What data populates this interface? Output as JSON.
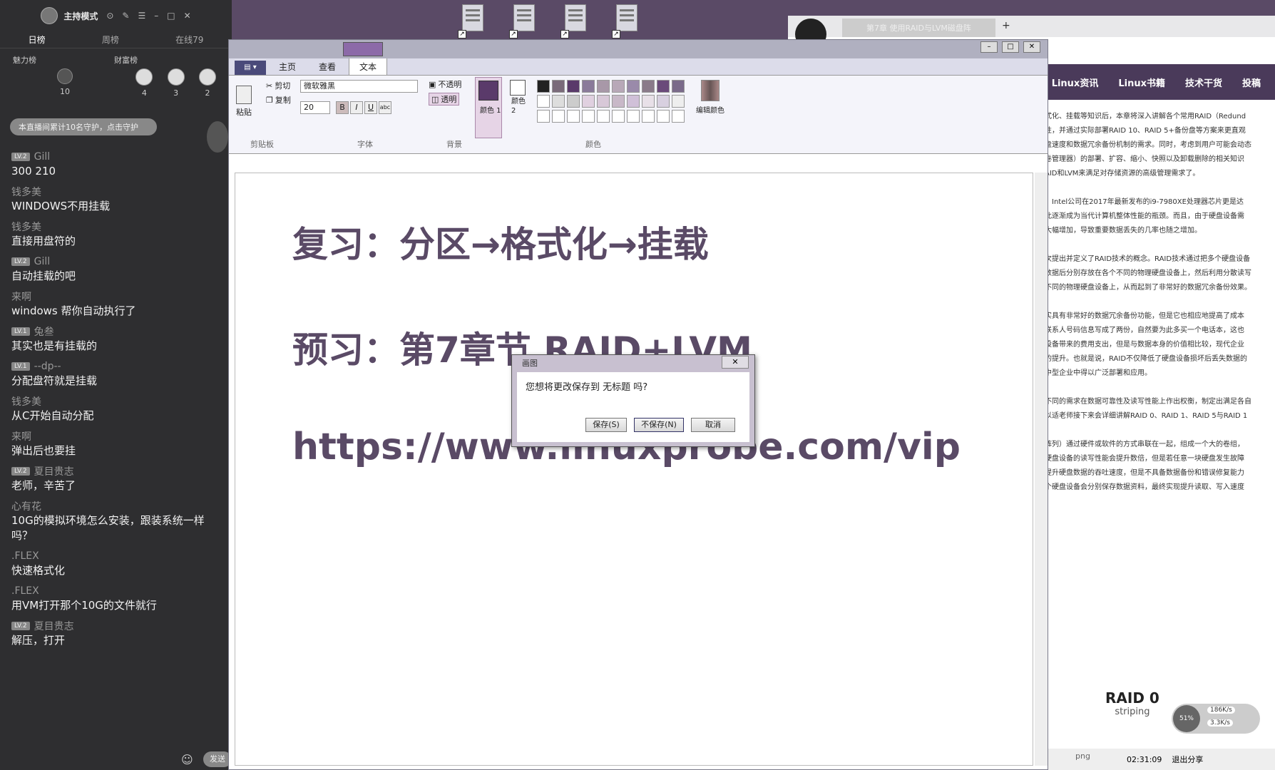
{
  "live_panel": {
    "title": "主持模式",
    "tabs": [
      "日榜",
      "周榜",
      "在线79"
    ],
    "rank_labels": {
      "charm": "魅力榜",
      "wealth": "财富榜"
    },
    "rank_counts": [
      "10",
      "4",
      "3",
      "2"
    ],
    "announcement": "本直播间累计10名守护，点击守护",
    "messages": [
      {
        "user": "Gill",
        "level": "LV.2",
        "text": "300 210"
      },
      {
        "user": "钱多美",
        "level": "",
        "text": "WINDOWS不用挂载"
      },
      {
        "user": "钱多美",
        "level": "",
        "text": "直接用盘符的"
      },
      {
        "user": "Gill",
        "level": "LV.2",
        "text": "自动挂载的吧"
      },
      {
        "user": "来啊",
        "level": "",
        "text": "windows 帮你自动执行了"
      },
      {
        "user": "兔叁",
        "level": "LV.1",
        "text": "其实也是有挂载的"
      },
      {
        "user": "--dp--",
        "level": "LV.1",
        "text": "分配盘符就是挂载"
      },
      {
        "user": "钱多美",
        "level": "",
        "text": "从C开始自动分配"
      },
      {
        "user": "来啊",
        "level": "",
        "text": "弹出后也要挂"
      },
      {
        "user": "夏目贵志",
        "level": "LV.2",
        "text": "老师，辛苦了"
      },
      {
        "user": "心有花",
        "level": "",
        "text": "10G的模拟环境怎么安装，跟装系统一样吗？"
      },
      {
        "user": ".FLEX",
        "level": "",
        "text": "快速格式化"
      },
      {
        "user": ".FLEX",
        "level": "",
        "text": "用VM打开那个10G的文件就行"
      },
      {
        "user": "夏目贵志",
        "level": "LV.2",
        "text": "解压，打开"
      }
    ],
    "send_label": "发送"
  },
  "paint": {
    "tabs": [
      "主页",
      "查看",
      "文本"
    ],
    "active_tab": "文本",
    "clipboard": {
      "paste": "粘贴",
      "cut": "剪切",
      "copy": "复制",
      "group": "剪贴板"
    },
    "font": {
      "name": "微软雅黑",
      "size": "20",
      "group": "字体",
      "bold": "B",
      "italic": "I",
      "underline": "U",
      "strike": "abc"
    },
    "background": {
      "opaque": "不透明",
      "transparent": "透明",
      "group": "背景"
    },
    "colors": {
      "color1": "颜色 1",
      "color2": "颜色 2",
      "edit": "编辑颜色",
      "group": "颜色"
    },
    "canvas": {
      "line1": "复习：分区→格式化→挂载",
      "line2": "预习：第7章节   RAID+LVM",
      "line3": "https://www.linuxprobe.com/vip"
    }
  },
  "dialog": {
    "title": "画图",
    "message": "您想将更改保存到 无标题 吗?",
    "save": "保存(S)",
    "dont_save": "不保存(N)",
    "cancel": "取消"
  },
  "browser": {
    "tab_title": "第7章 使用RAID与LVM磁盘阵",
    "nav": [
      "Linux资讯",
      "Linux书籍",
      "技术干货",
      "投稿"
    ],
    "article": [
      "式化、挂载等知识后，本章将深入讲解各个常用RAID（Redund",
      "性，并通过实际部署RAID 10、RAID 5+备份盘等方案来更直观",
      "盘速度和数据冗余备份机制的需求。同时，考虑到用户可能会动态",
      "卷管理器）的部署、扩容、缩小、快照以及卸载删除的相关知识",
      "AID和LVM来满足对存储资源的高级管理需求了。",
      "，Intel公司在2017年最新发布的i9-7980XE处理器芯片更是达",
      "此逐渐成为当代计算机整体性能的瓶颈。而且，由于硬盘设备需",
      "大幅增加，导致重要数据丢失的几率也随之增加。",
      "次提出并定义了RAID技术的概念。RAID技术通过把多个硬盘设备",
      "数据后分别存放在各个不同的物理硬盘设备上，然后利用分散读写",
      "不同的物理硬盘设备上，从而起到了非常好的数据冗余备份效果。",
      "实具有非常好的数据冗余备份功能，但是它也相应地提高了成本",
      "联系人号码信息写成了两份，自然要为此多买一个电话本，这也",
      "设备带来的费用支出，但是与数据本身的价值相比较，现代企业",
      "的提升。也就是说，RAID不仅降低了硬盘设备损坏后丢失数据的",
      "中型企业中得以广泛部署和应用。",
      "不同的需求在数据可靠性及读写性能上作出权衡，制定出满足各自",
      "以适老师接下来会详细讲解RAID 0、RAID 1、RAID 5与RAID 1",
      "阵列）通过硬件或软件的方式串联在一起，组成一个大的卷组，",
      "硬盘设备的读写性能会提升数倍，但是若任意一块硬盘发生故障",
      "提升硬盘数据的吞吐速度，但是不具备数据备份和错误修复能力",
      "个硬盘设备会分别保存数据资料，最终实现提升读取、写入速度"
    ],
    "raid_title": "RAID 0",
    "raid_sub": "striping",
    "speed_pct": "51%",
    "speed_up": "186K/s",
    "speed_down": "3.3K/s",
    "png_label": "png",
    "timer": "02:31:09",
    "exit_share": "退出分享"
  }
}
